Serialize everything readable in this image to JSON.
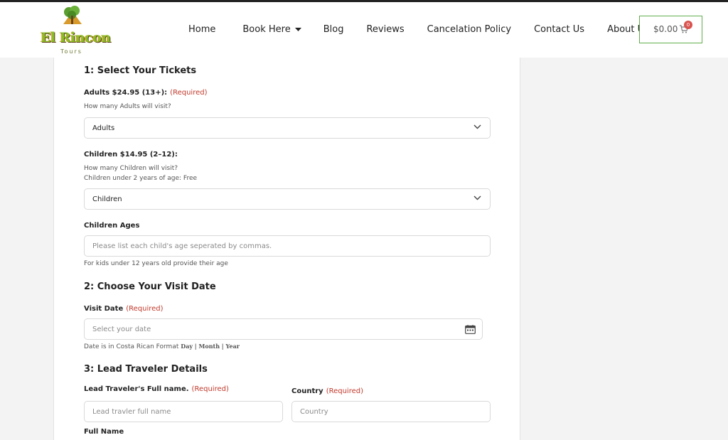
{
  "header": {
    "logo_text": "El Rincon",
    "logo_sub": "Tours",
    "nav": [
      {
        "label": "Home"
      },
      {
        "label": "Book Here"
      },
      {
        "label": "Blog"
      },
      {
        "label": "Reviews"
      },
      {
        "label": "Cancelation Policy"
      },
      {
        "label": "Contact Us"
      },
      {
        "label": "About Us"
      }
    ],
    "cart": {
      "amount": "$0.00",
      "count": "0"
    }
  },
  "form": {
    "section1": {
      "title": "1: Select Your Tickets"
    },
    "adults": {
      "label": "Adults $24.95 (13+):",
      "required": "(Required)",
      "help": "How many Adults will visit?",
      "value": "Adults"
    },
    "children": {
      "label": "Children $14.95 (2–12):",
      "help1": "How many Children will visit?",
      "help2": "Children under 2 years of age: Free",
      "value": "Children"
    },
    "children_ages": {
      "label": "Children Ages",
      "placeholder": "Please list each child's age seperated by commas.",
      "help": "For kids under 12 years old provide their age"
    },
    "section2": {
      "title": "2: Choose Your Visit Date"
    },
    "visit_date": {
      "label": "Visit Date",
      "required": "(Required)",
      "placeholder": "Select your date",
      "help_prefix": "Date is in Costa Rican Format",
      "help_format": "Day | Month | Year"
    },
    "section3": {
      "title": "3: Lead Traveler Details"
    },
    "lead_name": {
      "label": "Lead Traveler's Full name.",
      "required": "(Required)",
      "placeholder": "Lead travler full name"
    },
    "country": {
      "label": "Country",
      "required": "(Required)",
      "placeholder": "Country"
    },
    "full_name": {
      "label": "Full Name"
    }
  },
  "colors": {
    "accent_green": "#5fae4a",
    "required_red": "#c0392b",
    "badge_red": "#d9534f"
  }
}
